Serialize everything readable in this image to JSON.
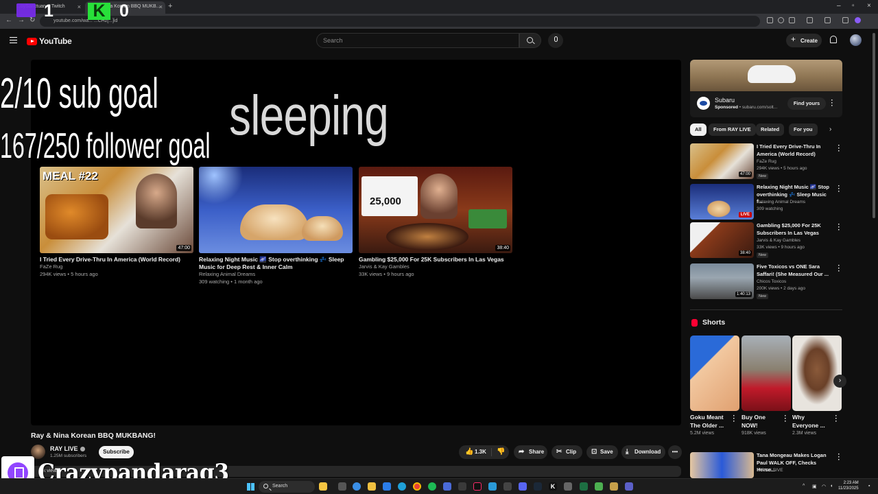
{
  "browser": {
    "tabs": [
      {
        "title": "...oySanctuary - Twitch",
        "active": false
      },
      {
        "title": "...Nina Korean BBQ MUKB...",
        "active": true
      }
    ],
    "url": "youtube.com/wa...    ...CHz[...]id"
  },
  "overlay": {
    "twitch_count": "1",
    "kick_letter": "K",
    "kick_count": "0",
    "sub_goal": "2/10 sub goal",
    "follower_goal": "167/250 follower goal",
    "status": "sleeping",
    "streamer": "Crazypandarag3"
  },
  "header": {
    "logo_text": "YouTube",
    "search_placeholder": "Search",
    "create_label": "Create"
  },
  "end_cards": [
    {
      "title": "I Tried Every Drive-Thru In America (World Record)",
      "channel": "FaZe Rug",
      "meta": "294K views • 5 hours ago",
      "duration": "47:00",
      "thumb_text": "MEAL #22"
    },
    {
      "title": "Relaxing Night Music 🌌 Stop overthinking 💤 Sleep Music for Deep Rest & Inner Calm",
      "channel": "Relaxing Animal Dreams",
      "meta": "309 watching • 1 month ago",
      "duration": "",
      "thumb_text": ""
    },
    {
      "title": "Gambling $25,000 For 25K Subscribers In Las Vegas",
      "channel": "Jarvis & Kay Gambles",
      "meta": "33K views • 9 hours ago",
      "duration": "38:40",
      "thumb_text": "25,000"
    }
  ],
  "video": {
    "title": "Ray & Nina Korean BBQ MUKBANG!",
    "channel": "RAY LIVE",
    "subscribers": "1.25M subscribers",
    "subscribe_label": "Subscribe",
    "likes": "1.3K",
    "share_label": "Share",
    "clip_label": "Clip",
    "save_label": "Save",
    "download_label": "Download",
    "desc_preview": "...k views..."
  },
  "ad": {
    "name": "Subaru",
    "sponsored": "Sponsored",
    "domain": "subaru.com/solt...",
    "cta": "Find yours"
  },
  "chips": [
    "All",
    "From RAY LIVE",
    "Related",
    "For you"
  ],
  "recommendations": [
    {
      "title": "I Tried Every Drive-Thru In America (World Record)",
      "channel": "FaZe Rug",
      "views": "294K views • 5 hours ago",
      "badge": "New",
      "duration": "47:00",
      "live": false
    },
    {
      "title": "Relaxing Night Music 🌌 Stop overthinking 💤 Sleep Music f...",
      "channel": "Relaxing Animal Dreams",
      "views": "309 watching",
      "badge": "",
      "duration": "",
      "live": true,
      "live_label": "LIVE"
    },
    {
      "title": "Gambling $25,000 For 25K Subscribers In Las Vegas",
      "channel": "Jarvis & Kay Gambles",
      "views": "33K views • 9 hours ago",
      "badge": "New",
      "duration": "38:40",
      "live": false
    },
    {
      "title": "Five Toxicos vs ONE Sara Saffari! (She Measured Our ...",
      "channel": "Chicos Toxicos",
      "views": "200K views • 2 days ago",
      "badge": "New",
      "duration": "1:40:13",
      "live": false
    }
  ],
  "shorts": {
    "heading": "Shorts",
    "items": [
      {
        "title": "Goku Meant The Older ...",
        "views": "5.2M views"
      },
      {
        "title": "Buy One NOW!",
        "views": "918K views"
      },
      {
        "title": "Why Everyone ...",
        "views": "2.3M views"
      }
    ]
  },
  "bottom_rec": {
    "title": "Tana Mongeau Makes Logan Paul WALK OFF, Checks Herse...",
    "channel": "IMPAULSIVE"
  },
  "taskbar": {
    "search_label": "Search",
    "time": "2:23 AM",
    "date": "11/23/2025"
  }
}
